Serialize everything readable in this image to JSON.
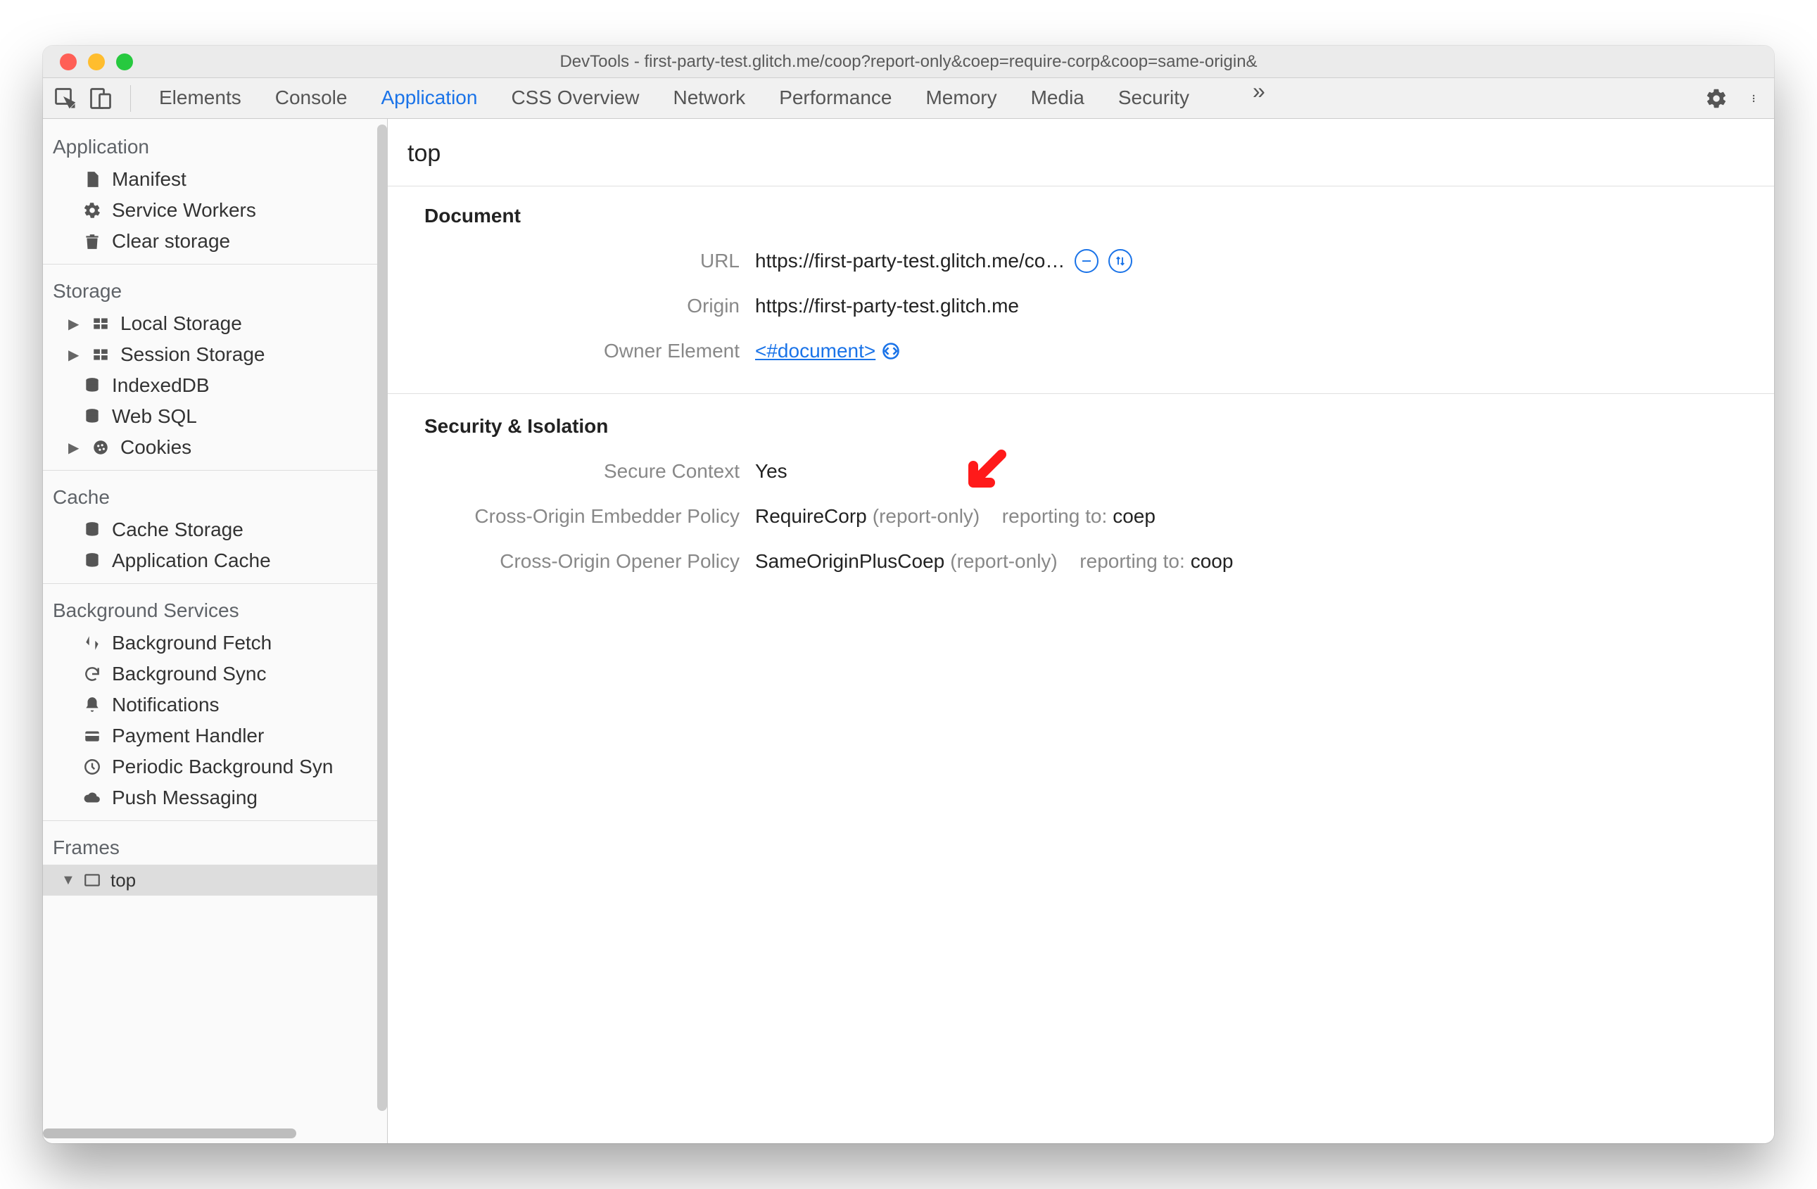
{
  "window": {
    "title": "DevTools - first-party-test.glitch.me/coop?report-only&coep=require-corp&coop=same-origin&"
  },
  "toolbar": {
    "tabs": [
      {
        "label": "Elements",
        "active": false
      },
      {
        "label": "Console",
        "active": false
      },
      {
        "label": "Application",
        "active": true
      },
      {
        "label": "CSS Overview",
        "active": false
      },
      {
        "label": "Network",
        "active": false
      },
      {
        "label": "Performance",
        "active": false
      },
      {
        "label": "Memory",
        "active": false
      },
      {
        "label": "Media",
        "active": false
      },
      {
        "label": "Security",
        "active": false
      }
    ]
  },
  "sidebar": {
    "application": {
      "title": "Application",
      "items": [
        {
          "label": "Manifest",
          "icon": "doc"
        },
        {
          "label": "Service Workers",
          "icon": "gear"
        },
        {
          "label": "Clear storage",
          "icon": "trash"
        }
      ]
    },
    "storage": {
      "title": "Storage",
      "items": [
        {
          "label": "Local Storage",
          "icon": "grid",
          "expandable": true
        },
        {
          "label": "Session Storage",
          "icon": "grid",
          "expandable": true
        },
        {
          "label": "IndexedDB",
          "icon": "db"
        },
        {
          "label": "Web SQL",
          "icon": "db"
        },
        {
          "label": "Cookies",
          "icon": "cookie",
          "expandable": true
        }
      ]
    },
    "cache": {
      "title": "Cache",
      "items": [
        {
          "label": "Cache Storage",
          "icon": "db"
        },
        {
          "label": "Application Cache",
          "icon": "db"
        }
      ]
    },
    "background": {
      "title": "Background Services",
      "items": [
        {
          "label": "Background Fetch",
          "icon": "updown"
        },
        {
          "label": "Background Sync",
          "icon": "sync"
        },
        {
          "label": "Notifications",
          "icon": "bell"
        },
        {
          "label": "Payment Handler",
          "icon": "card"
        },
        {
          "label": "Periodic Background Syn",
          "icon": "clock"
        },
        {
          "label": "Push Messaging",
          "icon": "cloud"
        }
      ]
    },
    "frames": {
      "title": "Frames",
      "items": [
        {
          "label": "top",
          "icon": "frame",
          "active": true
        }
      ]
    }
  },
  "content": {
    "title": "top",
    "document": {
      "heading": "Document",
      "url_label": "URL",
      "url": "https://first-party-test.glitch.me/co…",
      "origin_label": "Origin",
      "origin": "https://first-party-test.glitch.me",
      "owner_label": "Owner Element",
      "owner": "<#document>"
    },
    "security": {
      "heading": "Security & Isolation",
      "secure_context_label": "Secure Context",
      "secure_context": "Yes",
      "coep_label": "Cross-Origin Embedder Policy",
      "coep_value": "RequireCorp",
      "coep_badge": "(report-only)",
      "coep_reporting_label": "reporting to:",
      "coep_reporting": "coep",
      "coop_label": "Cross-Origin Opener Policy",
      "coop_value": "SameOriginPlusCoep",
      "coop_badge": "(report-only)",
      "coop_reporting_label": "reporting to:",
      "coop_reporting": "coop"
    }
  }
}
